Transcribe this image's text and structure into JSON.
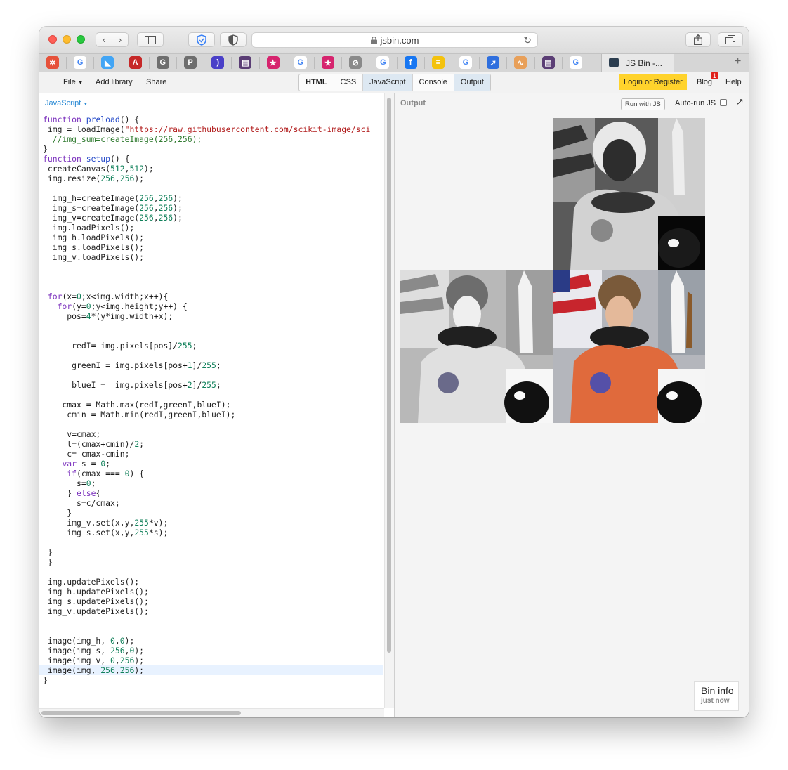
{
  "browser": {
    "address": "jsbin.com",
    "lock_icon": "lock-icon",
    "active_tab_title": "JS Bin -...",
    "favicons": [
      {
        "name": "pinwheel-favicon",
        "color": "#e6513a",
        "glyph": "✲"
      },
      {
        "name": "google-favicon",
        "color": "#ffffff",
        "glyph": "G"
      },
      {
        "name": "flutter-favicon",
        "color": "#42a5f5",
        "glyph": "◣"
      },
      {
        "name": "badge-favicon",
        "color": "#c62828",
        "glyph": "A"
      },
      {
        "name": "g-gray-favicon",
        "color": "#6e6e6e",
        "glyph": "G"
      },
      {
        "name": "p-favicon",
        "color": "#6e6e6e",
        "glyph": "P"
      },
      {
        "name": "bracket-favicon",
        "color": "#4a40c8",
        "glyph": ")"
      },
      {
        "name": "purple-book-favicon",
        "color": "#5b3e75",
        "glyph": "▤"
      },
      {
        "name": "star-favicon",
        "color": "#d6246e",
        "glyph": "★"
      },
      {
        "name": "google-favicon",
        "color": "#ffffff",
        "glyph": "G"
      },
      {
        "name": "star-favicon",
        "color": "#d6246e",
        "glyph": "★"
      },
      {
        "name": "compass-favicon",
        "color": "#8a8a8a",
        "glyph": "⊘"
      },
      {
        "name": "google-favicon",
        "color": "#ffffff",
        "glyph": "G"
      },
      {
        "name": "facebook-favicon",
        "color": "#1877f2",
        "glyph": "f"
      },
      {
        "name": "stripes-favicon",
        "color": "#f4c20d",
        "glyph": "≡"
      },
      {
        "name": "google-favicon",
        "color": "#ffffff",
        "glyph": "G"
      },
      {
        "name": "rocket-favicon",
        "color": "#2f6fde",
        "glyph": "➚"
      },
      {
        "name": "chart-favicon",
        "color": "#e8a05a",
        "glyph": "∿"
      },
      {
        "name": "purple-book-favicon",
        "color": "#5b3e75",
        "glyph": "▤"
      },
      {
        "name": "google-favicon",
        "color": "#ffffff",
        "glyph": "G"
      }
    ]
  },
  "toolbar": {
    "file_label": "File",
    "add_library_label": "Add library",
    "share_label": "Share",
    "tabs": [
      "HTML",
      "CSS",
      "JavaScript",
      "Console",
      "Output"
    ],
    "login_label": "Login or Register",
    "blog_label": "Blog",
    "blog_badge": "1",
    "help_label": "Help"
  },
  "editor": {
    "language_label": "JavaScript",
    "lines": [
      {
        "t": "function preload() {",
        "s": [
          [
            "kw",
            "function"
          ],
          [
            "",
            ""
          ]
        ]
      },
      {
        "t": " img = loadImage(\"https://raw.githubusercontent.com/scikit-image/sci"
      },
      {
        "t": "  //img_sum=createImage(256,256);"
      },
      {
        "t": "}"
      },
      {
        "t": "function setup() {"
      },
      {
        "t": " createCanvas(512,512);"
      },
      {
        "t": " img.resize(256,256);"
      },
      {
        "t": ""
      },
      {
        "t": "  img_h=createImage(256,256);"
      },
      {
        "t": "  img_s=createImage(256,256);"
      },
      {
        "t": "  img_v=createImage(256,256);"
      },
      {
        "t": "  img.loadPixels();"
      },
      {
        "t": "  img_h.loadPixels();"
      },
      {
        "t": "  img_s.loadPixels();"
      },
      {
        "t": "  img_v.loadPixels();"
      },
      {
        "t": ""
      },
      {
        "t": ""
      },
      {
        "t": ""
      },
      {
        "t": " for(x=0;x<img.width;x++){"
      },
      {
        "t": "   for(y=0;y<img.height;y++) {"
      },
      {
        "t": "     pos=4*(y*img.width+x);"
      },
      {
        "t": ""
      },
      {
        "t": ""
      },
      {
        "t": "      redI= img.pixels[pos]/255;"
      },
      {
        "t": ""
      },
      {
        "t": "      greenI = img.pixels[pos+1]/255;"
      },
      {
        "t": ""
      },
      {
        "t": "      blueI =  img.pixels[pos+2]/255;"
      },
      {
        "t": ""
      },
      {
        "t": "    cmax = Math.max(redI,greenI,blueI);"
      },
      {
        "t": "     cmin = Math.min(redI,greenI,blueI);"
      },
      {
        "t": ""
      },
      {
        "t": "     v=cmax;"
      },
      {
        "t": "     l=(cmax+cmin)/2;"
      },
      {
        "t": "     c= cmax-cmin;"
      },
      {
        "t": "    var s = 0;"
      },
      {
        "t": "     if(cmax === 0) {"
      },
      {
        "t": "       s=0;"
      },
      {
        "t": "     } else{"
      },
      {
        "t": "       s=c/cmax;"
      },
      {
        "t": "     }"
      },
      {
        "t": "     img_v.set(x,y,255*v);"
      },
      {
        "t": "     img_s.set(x,y,255*s);"
      },
      {
        "t": ""
      },
      {
        "t": " }"
      },
      {
        "t": " }"
      },
      {
        "t": ""
      },
      {
        "t": " img.updatePixels();"
      },
      {
        "t": " img_h.updatePixels();"
      },
      {
        "t": " img_s.updatePixels();"
      },
      {
        "t": " img_v.updatePixels();"
      },
      {
        "t": ""
      },
      {
        "t": ""
      },
      {
        "t": " image(img_h, 0,0);"
      },
      {
        "t": " image(img_s, 256,0);"
      },
      {
        "t": " image(img_v, 0,256);"
      },
      {
        "t": " image(img, 256,256);"
      },
      {
        "t": "}"
      }
    ]
  },
  "output": {
    "label": "Output",
    "run_button_label": "Run with JS",
    "autorun_label": "Auto-run JS",
    "autorun_checked": false,
    "popout_icon": "popout-arrow-icon",
    "bin_info_title": "Bin info",
    "bin_info_subtitle": "just now"
  },
  "colors": {
    "accent_login": "#ffd32c",
    "badge_red": "#e0211b",
    "tab_active": "#dde8f2",
    "link_blue": "#2a8ad4"
  }
}
